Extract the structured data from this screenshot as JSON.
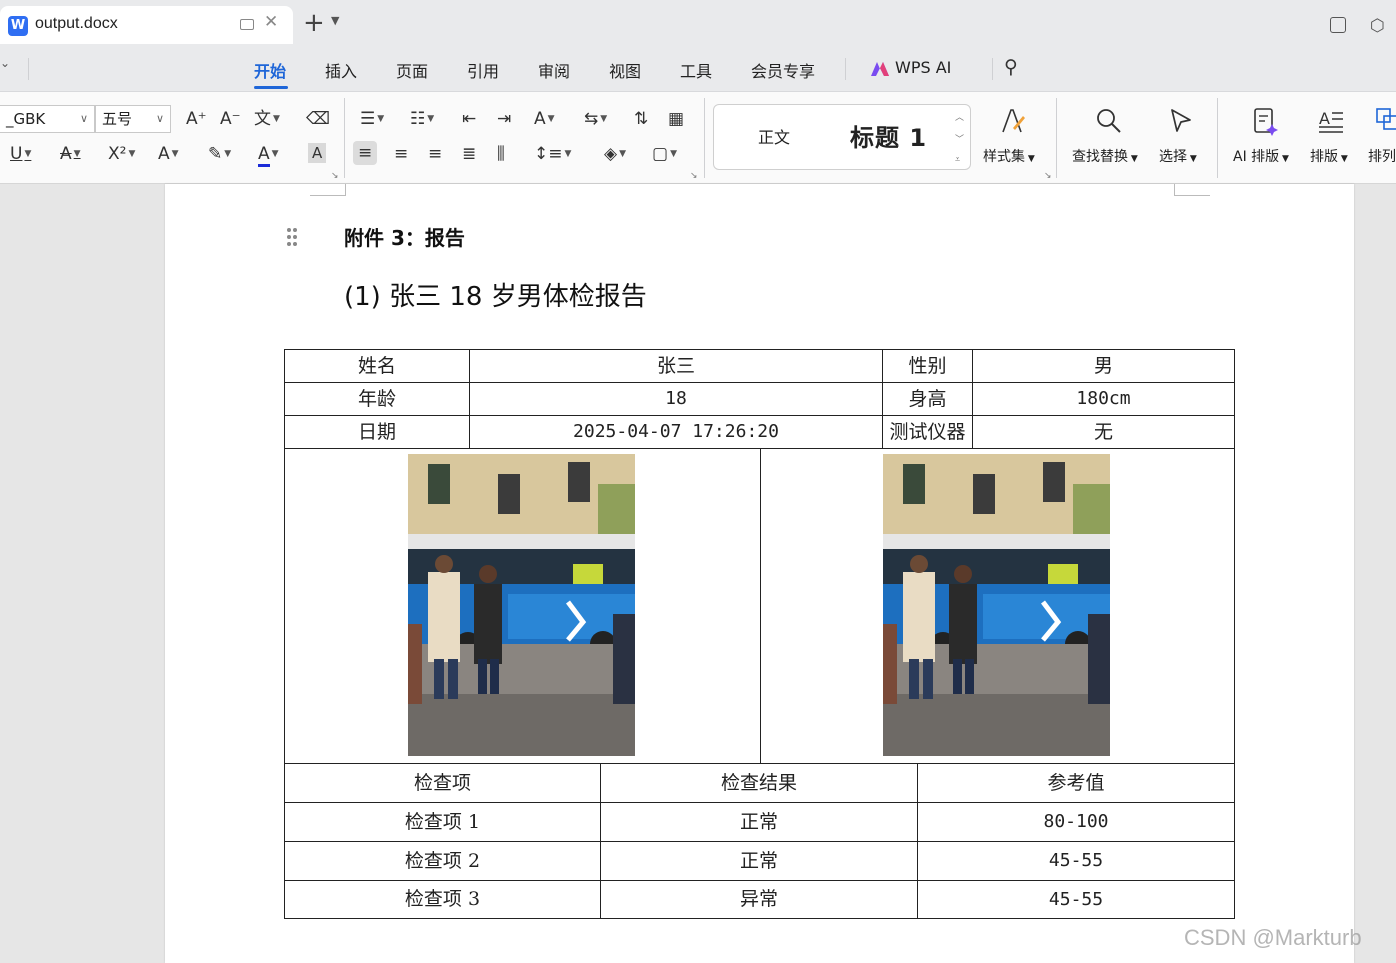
{
  "titlebar": {
    "logo": "W",
    "tab_title": "output.docx",
    "new_tab": "+",
    "tab_menu": "⌄"
  },
  "menu": {
    "items": [
      "开始",
      "插入",
      "页面",
      "引用",
      "审阅",
      "视图",
      "工具",
      "会员专享",
      "WPS AI"
    ],
    "active_index": 0
  },
  "ribbon": {
    "font_name": "_GBK",
    "font_size": "五号",
    "styles": {
      "normal": "正文",
      "heading1": "标题 1"
    },
    "style_set_label": "样式集",
    "find_replace_label": "查找替换",
    "select_label": "选择",
    "ai_layout_label": "AI 排版",
    "layout_label": "排版",
    "arrange_label": "排列",
    "accent_color": "#1f66d8"
  },
  "document": {
    "attachment_heading": "附件 3：报告",
    "report_title": "(1)  张三 18 岁男体检报告",
    "info_table": {
      "rows": [
        [
          "姓名",
          "张三",
          "性别",
          "男"
        ],
        [
          "年龄",
          "18",
          "身高",
          "180cm"
        ],
        [
          "日期",
          "2025-04-07 17:26:20",
          "测试仪器",
          "无"
        ]
      ]
    },
    "results_table": {
      "headers": [
        "检查项",
        "检查结果",
        "参考值"
      ],
      "rows": [
        [
          "检查项 1",
          "正常",
          "80-100"
        ],
        [
          "检查项 2",
          "正常",
          "45-55"
        ],
        [
          "检查项 3",
          "异常",
          "45-55"
        ]
      ]
    }
  },
  "watermark": "CSDN @Markturb"
}
